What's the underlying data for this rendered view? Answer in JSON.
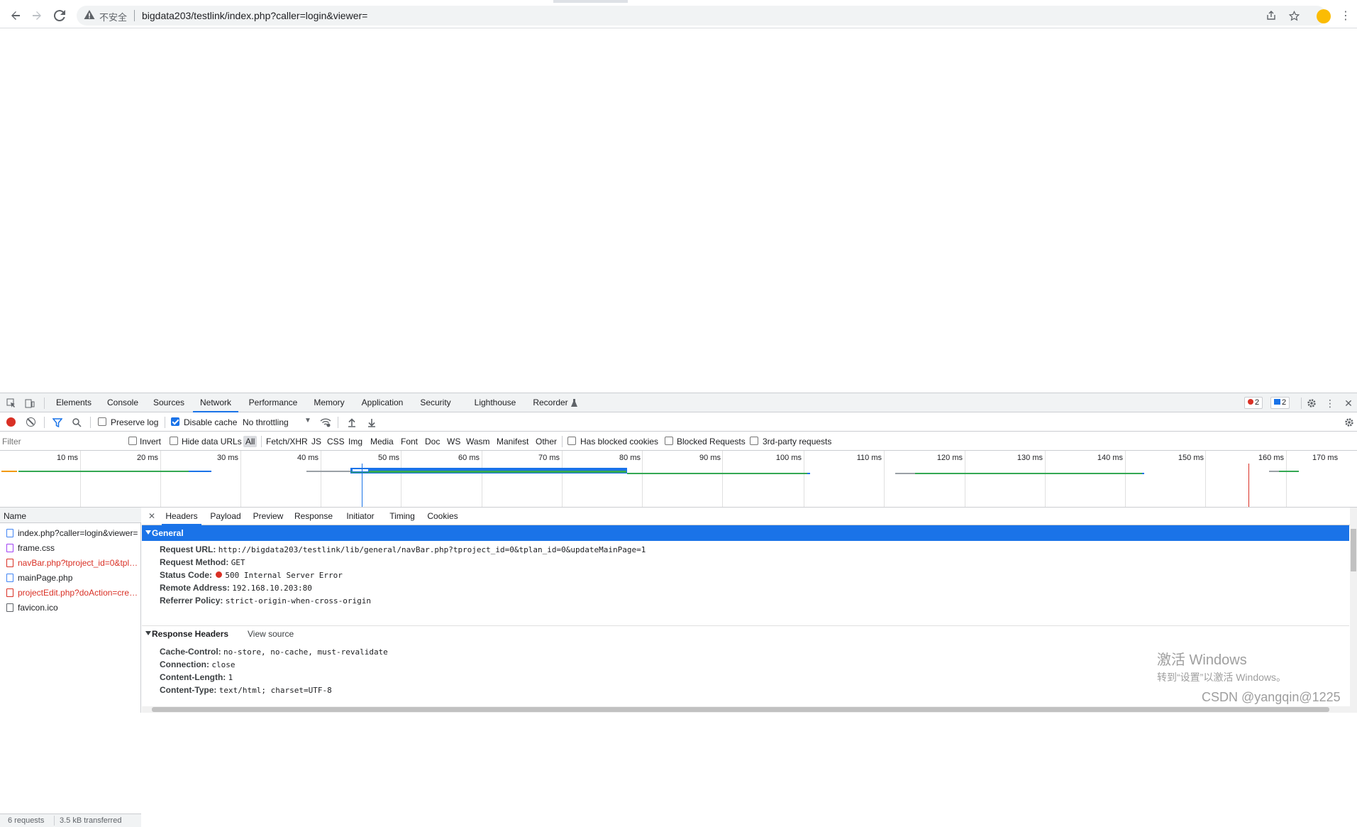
{
  "browser": {
    "insecure_label": "不安全",
    "url": "bigdata203/testlink/index.php?caller=login&viewer="
  },
  "devtools": {
    "tabs": [
      "Elements",
      "Console",
      "Sources",
      "Network",
      "Performance",
      "Memory",
      "Application",
      "Security",
      "Lighthouse",
      "Recorder"
    ],
    "active_tab": "Network",
    "error_count": "2",
    "message_count": "2",
    "network_toolbar": {
      "preserve_log": "Preserve log",
      "disable_cache": "Disable cache",
      "throttling": "No throttling"
    },
    "filter_bar": {
      "placeholder": "Filter",
      "invert": "Invert",
      "hide_data_urls": "Hide data URLs",
      "types": [
        "All",
        "Fetch/XHR",
        "JS",
        "CSS",
        "Img",
        "Media",
        "Font",
        "Doc",
        "WS",
        "Wasm",
        "Manifest",
        "Other"
      ],
      "active_type": "All",
      "has_blocked_cookies": "Has blocked cookies",
      "blocked_requests": "Blocked Requests",
      "third_party": "3rd-party requests"
    },
    "timeline_ticks": [
      "10 ms",
      "20 ms",
      "30 ms",
      "40 ms",
      "50 ms",
      "60 ms",
      "70 ms",
      "80 ms",
      "90 ms",
      "100 ms",
      "110 ms",
      "120 ms",
      "130 ms",
      "140 ms",
      "150 ms",
      "160 ms",
      "170 ms"
    ],
    "name_column": "Name",
    "requests": [
      {
        "name": "index.php?caller=login&viewer=",
        "error": false,
        "icon": "doc"
      },
      {
        "name": "frame.css",
        "error": false,
        "icon": "css"
      },
      {
        "name": "navBar.php?tproject_id=0&tplan_id=0&updateMainPage=1",
        "error": true,
        "icon": "doc"
      },
      {
        "name": "mainPage.php",
        "error": false,
        "icon": "doc"
      },
      {
        "name": "projectEdit.php?doAction=create",
        "error": true,
        "icon": "doc"
      },
      {
        "name": "favicon.ico",
        "error": false,
        "icon": "other"
      }
    ],
    "status": {
      "requests": "6 requests",
      "transferred": "3.5 kB transferred"
    },
    "detail_tabs": [
      "Headers",
      "Payload",
      "Preview",
      "Response",
      "Initiator",
      "Timing",
      "Cookies"
    ],
    "active_detail_tab": "Headers",
    "general": {
      "title": "General",
      "rows": [
        {
          "key": "Request URL:",
          "value": "http://bigdata203/testlink/lib/general/navBar.php?tproject_id=0&tplan_id=0&updateMainPage=1"
        },
        {
          "key": "Request Method:",
          "value": "GET"
        },
        {
          "key": "Status Code:",
          "value": "500 Internal Server Error"
        },
        {
          "key": "Remote Address:",
          "value": "192.168.10.203:80"
        },
        {
          "key": "Referrer Policy:",
          "value": "strict-origin-when-cross-origin"
        }
      ]
    },
    "response_headers": {
      "title": "Response Headers",
      "view_source": "View source",
      "rows": [
        {
          "key": "Cache-Control:",
          "value": "no-store, no-cache, must-revalidate"
        },
        {
          "key": "Connection:",
          "value": "close"
        },
        {
          "key": "Content-Length:",
          "value": "1"
        },
        {
          "key": "Content-Type:",
          "value": "text/html; charset=UTF-8"
        }
      ]
    }
  },
  "overlay": {
    "activate_title": "激活 Windows",
    "activate_sub": "转到“设置”以激活 Windows。",
    "csdn": "CSDN @yangqin@1225"
  },
  "colors": {
    "accent": "#1a73e8",
    "error": "#d93025",
    "bar_green": "#34a853"
  }
}
